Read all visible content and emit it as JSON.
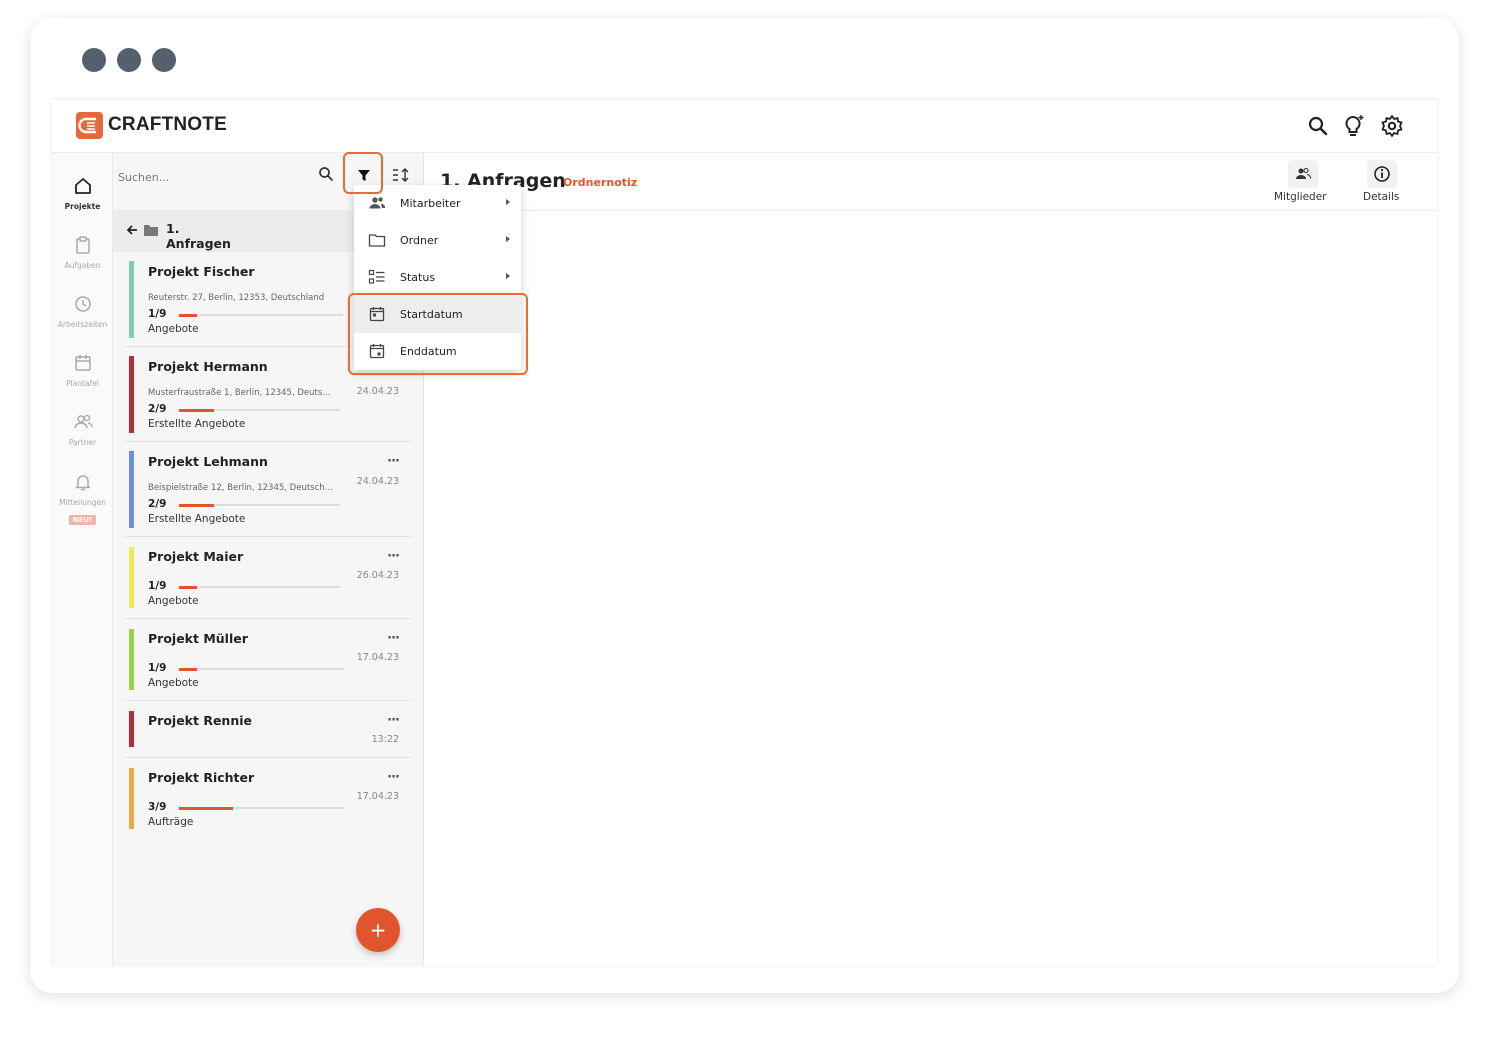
{
  "app": {
    "name": "CRAFTNOTE"
  },
  "nav": {
    "items": [
      {
        "label": "Projekte",
        "icon": "home-icon",
        "active": true
      },
      {
        "label": "Aufgaben",
        "icon": "clipboard-icon",
        "active": false
      },
      {
        "label": "Arbeitszeiten",
        "icon": "clock-icon",
        "active": false
      },
      {
        "label": "Plantafel",
        "icon": "calendar-icon",
        "active": false
      },
      {
        "label": "Partner",
        "icon": "people-icon",
        "active": false
      },
      {
        "label": "Mitteilungen",
        "icon": "bell-icon",
        "active": false,
        "badge": "NEU!"
      }
    ]
  },
  "list": {
    "search_placeholder": "Suchen...",
    "breadcrumb": "1. Anfragen",
    "projects": [
      {
        "title": "Projekt Fischer",
        "address": "Reuterstr. 27, Berlin, 12353, Deutschland",
        "fraction": "1/9",
        "progress": 0.11,
        "status": "Angebote",
        "date": "",
        "color": "#7fd0b0"
      },
      {
        "title": "Projekt Hermann",
        "address": "Musterfraustraße 1, Berlin, 12345, Deuts...",
        "fraction": "2/9",
        "progress": 0.22,
        "status": "Erstellte Angebote",
        "date": "24.04.23",
        "color": "#b02d3a"
      },
      {
        "title": "Projekt Lehmann",
        "address": "Beispielstraße 12, Berlin, 12345, Deutsch...",
        "fraction": "2/9",
        "progress": 0.22,
        "status": "Erstellte Angebote",
        "date": "24.04.23",
        "color": "#6f8fd8"
      },
      {
        "title": "Projekt Maier",
        "address": "",
        "fraction": "1/9",
        "progress": 0.11,
        "status": "Angebote",
        "date": "26.04.23",
        "color": "#efe85a"
      },
      {
        "title": "Projekt Müller",
        "address": "",
        "fraction": "1/9",
        "progress": 0.11,
        "status": "Angebote",
        "date": "17.04.23",
        "color": "#9ad24a"
      },
      {
        "title": "Projekt Rennie",
        "address": "",
        "fraction": "",
        "progress": 0,
        "status": "",
        "date": "13:22",
        "color": "#b02d3a"
      },
      {
        "title": "Projekt Richter",
        "address": "",
        "fraction": "3/9",
        "progress": 0.33,
        "status": "Aufträge",
        "date": "17.04.23",
        "color": "#e8a94a"
      }
    ],
    "more_label": "···",
    "fab_label": "+"
  },
  "main": {
    "title": "1. Anfragen",
    "note_label": "Ordnernotiz",
    "members_label": "Mitglieder",
    "details_label": "Details"
  },
  "filter_menu": {
    "items": [
      {
        "label": "Mitarbeiter",
        "icon": "people-icon",
        "submenu": true
      },
      {
        "label": "Ordner",
        "icon": "folder-icon",
        "submenu": true
      },
      {
        "label": "Status",
        "icon": "checklist-icon",
        "submenu": true
      },
      {
        "label": "Startdatum",
        "icon": "calendar-start-icon",
        "submenu": false
      },
      {
        "label": "Enddatum",
        "icon": "calendar-end-icon",
        "submenu": false
      }
    ]
  },
  "colors": {
    "accent": "#e0552c",
    "highlight": "#ef6a33"
  }
}
